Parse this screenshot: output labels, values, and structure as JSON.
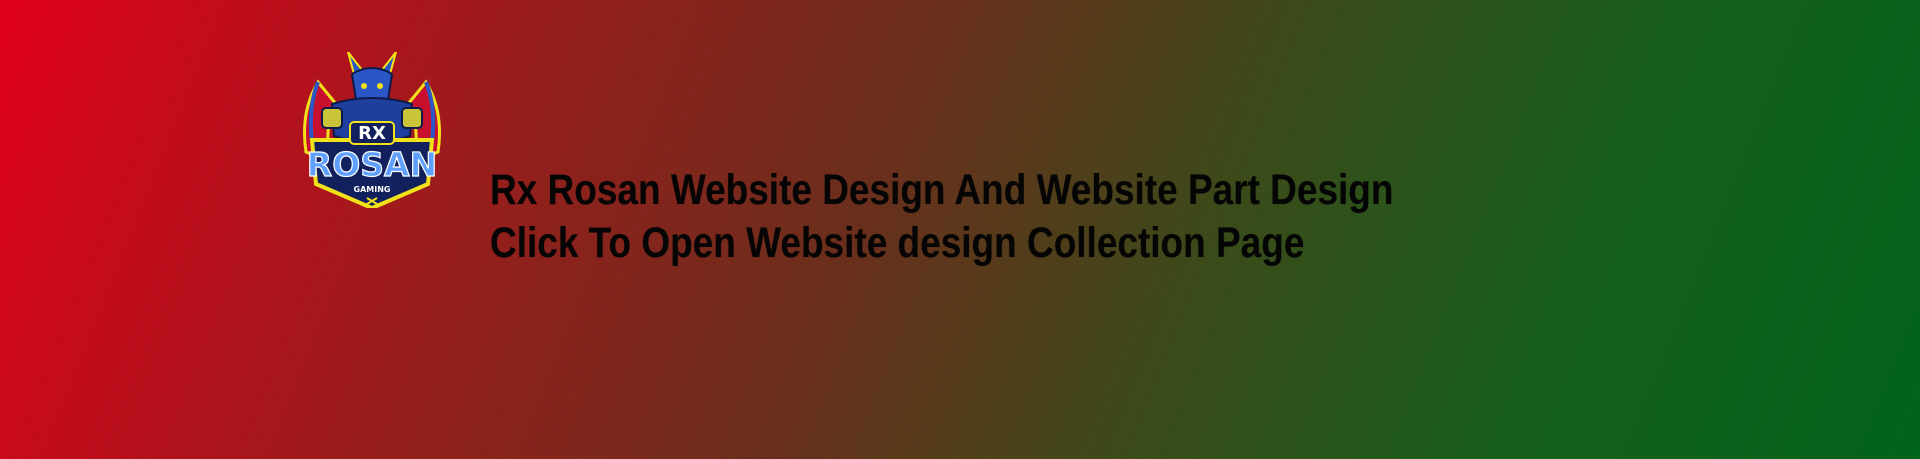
{
  "logo": {
    "top_text": "RX",
    "main_text": "ROSAN",
    "sub_text": "GAMING",
    "icon": "dragon-mascot-icon",
    "colors": {
      "shield_outline": "#f2e21a",
      "shield_fill": "#12215e",
      "dragon_blue": "#2a56c6",
      "wings_red": "#c8102e",
      "text_white": "#ffffff"
    }
  },
  "headline": {
    "line1": "Rx Rosan Website Design And Website Part Design",
    "line2": "Click To Open Website design Collection Page"
  },
  "background": {
    "gradient_start": "#e1001c",
    "gradient_end": "#00631a"
  }
}
